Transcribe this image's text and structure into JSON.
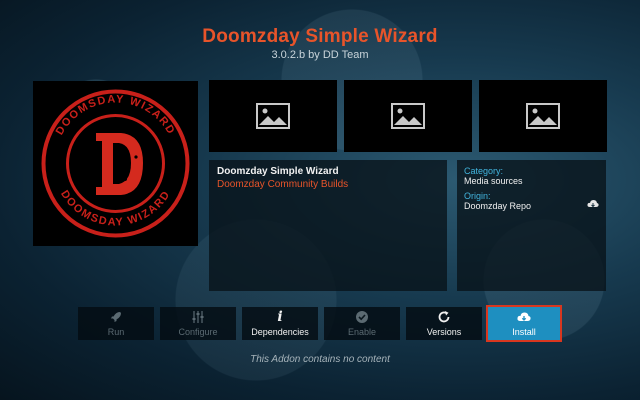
{
  "addon": {
    "name": "Doomzday Simple Wizard",
    "version_line": "3.0.2.b by DD Team",
    "author": "Doomzday Community Builds",
    "logo_ring_text": "DOOMSDAY WIZARD"
  },
  "meta": {
    "category_label": "Category:",
    "category_value": "Media sources",
    "origin_label": "Origin:",
    "origin_value": "Doomzday Repo"
  },
  "buttons": [
    {
      "label": "Run",
      "icon": "rocket-icon",
      "enabled": false
    },
    {
      "label": "Configure",
      "icon": "sliders-icon",
      "enabled": false
    },
    {
      "label": "Dependencies",
      "icon": "info-icon",
      "enabled": true
    },
    {
      "label": "Enable",
      "icon": "check-icon",
      "enabled": false
    },
    {
      "label": "Versions",
      "icon": "refresh-icon",
      "enabled": true
    },
    {
      "label": "Install",
      "icon": "cloud-download-icon",
      "enabled": true,
      "focused": true
    }
  ],
  "footer": "This Addon contains no content",
  "colors": {
    "accent_orange": "#e8542a",
    "label_blue": "#42b4dd",
    "install_blue": "#1e8fc0",
    "focus_red": "#d9371f"
  }
}
